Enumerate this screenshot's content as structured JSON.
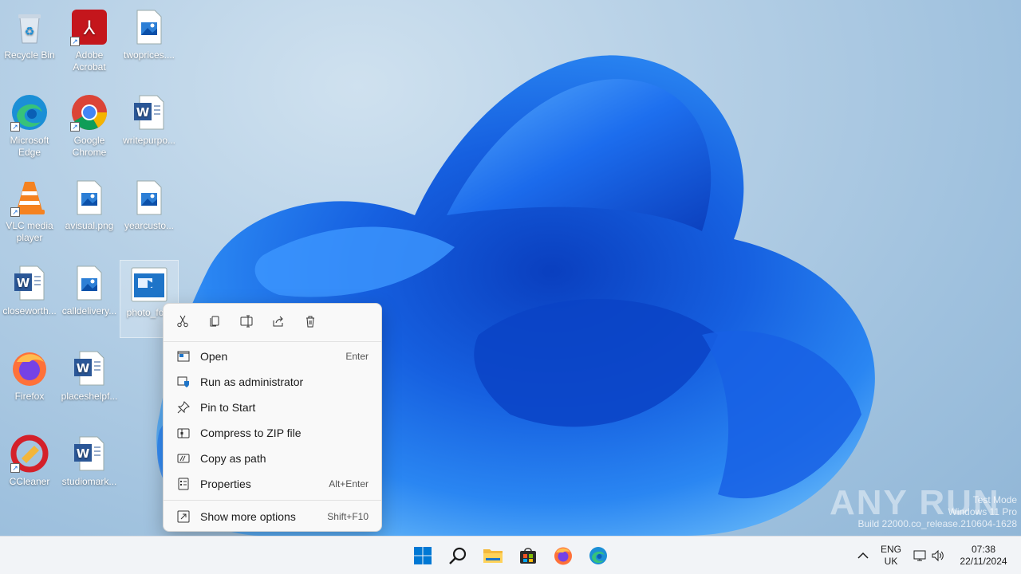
{
  "desktop": {
    "icons": [
      {
        "label": "Recycle Bin",
        "icon": "recycle-bin-icon"
      },
      {
        "label": "Adobe Acrobat",
        "icon": "adobe-acrobat-icon"
      },
      {
        "label": "twoprices....",
        "icon": "image-file-icon"
      },
      {
        "label": "Microsoft Edge",
        "icon": "edge-icon"
      },
      {
        "label": "Google Chrome",
        "icon": "chrome-icon"
      },
      {
        "label": "writepurpo...",
        "icon": "word-doc-icon"
      },
      {
        "label": "VLC media player",
        "icon": "vlc-icon"
      },
      {
        "label": "avisual.png",
        "icon": "image-file-icon"
      },
      {
        "label": "yearcusto...",
        "icon": "image-file-icon"
      },
      {
        "label": "closeworth...",
        "icon": "word-doc-icon"
      },
      {
        "label": "calldelivery...",
        "icon": "image-file-icon"
      },
      {
        "label": "photo_fo...",
        "icon": "video-file-icon"
      },
      {
        "label": "Firefox",
        "icon": "firefox-icon"
      },
      {
        "label": "placeshelpf...",
        "icon": "word-doc-icon"
      },
      {
        "label": "CCleaner",
        "icon": "ccleaner-icon"
      },
      {
        "label": "studiomark...",
        "icon": "word-doc-icon"
      }
    ]
  },
  "context_menu": {
    "toolbar": [
      "cut-icon",
      "copy-icon",
      "rename-icon",
      "share-icon",
      "delete-icon"
    ],
    "items": [
      {
        "label": "Open",
        "shortcut": "Enter",
        "icon": "open-icon"
      },
      {
        "label": "Run as administrator",
        "shortcut": "",
        "icon": "shield-icon"
      },
      {
        "label": "Pin to Start",
        "shortcut": "",
        "icon": "pin-icon"
      },
      {
        "label": "Compress to ZIP file",
        "shortcut": "",
        "icon": "zip-icon"
      },
      {
        "label": "Copy as path",
        "shortcut": "",
        "icon": "copy-path-icon"
      },
      {
        "label": "Properties",
        "shortcut": "Alt+Enter",
        "icon": "properties-icon"
      },
      {
        "label": "Show more options",
        "shortcut": "Shift+F10",
        "icon": "more-options-icon"
      }
    ]
  },
  "watermark": {
    "line1": "Test Mode",
    "line2": "Windows 11 Pro",
    "line3": "Build 22000.co_release.210604-1628",
    "brand": "ANY RUN"
  },
  "taskbar": {
    "apps": [
      "start-icon",
      "search-icon",
      "file-explorer-icon",
      "store-icon",
      "firefox-icon",
      "edge-icon"
    ],
    "language_line1": "ENG",
    "language_line2": "UK",
    "time": "07:38",
    "date": "22/11/2024"
  },
  "colors": {
    "accent": "#0067c0",
    "wallpaper_bloom": "#1a6fe8"
  }
}
